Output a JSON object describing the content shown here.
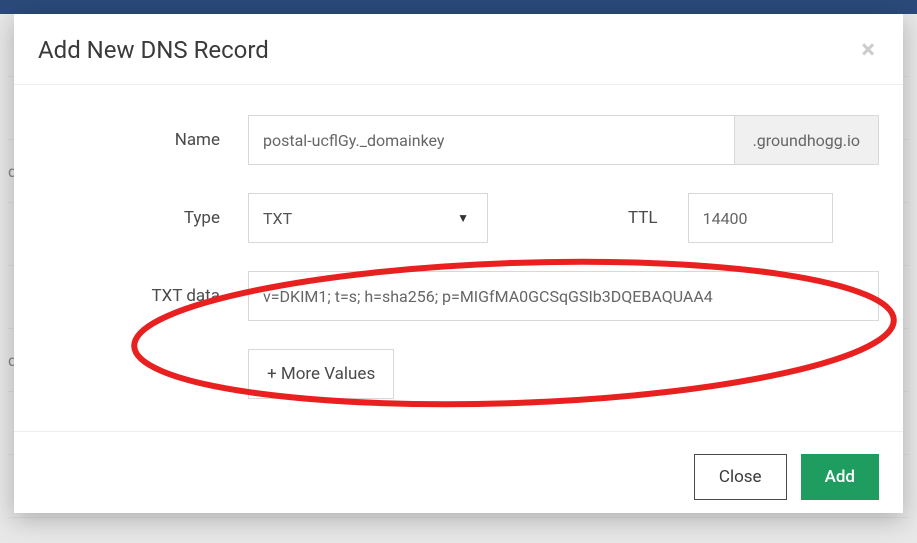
{
  "header": {
    "title": "Add New DNS Record"
  },
  "form": {
    "name_label": "Name",
    "name_value": "postal-ucflGy._domainkey",
    "domain_suffix": ".groundhogg.io",
    "type_label": "Type",
    "type_value": "TXT",
    "ttl_label": "TTL",
    "ttl_value": "14400",
    "txt_label": "TXT data",
    "txt_value": "v=DKIM1; t=s; h=sha256; p=MIGfMA0GCSqGSIb3DQEBAQUAA4",
    "more_values_label": "+ More Values"
  },
  "footer": {
    "close_label": "Close",
    "add_label": "Add"
  },
  "annotation": {
    "highlight_color": "#e92020"
  }
}
